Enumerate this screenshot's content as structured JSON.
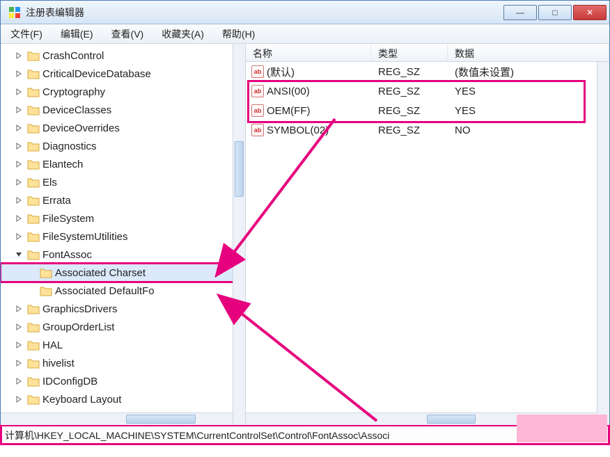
{
  "window": {
    "title": "注册表编辑器",
    "btn_min": "—",
    "btn_max": "□",
    "btn_close": "✕"
  },
  "menu": {
    "file": "文件(F)",
    "edit": "编辑(E)",
    "view": "查看(V)",
    "favorites": "收藏夹(A)",
    "help": "帮助(H)"
  },
  "tree": {
    "items": [
      {
        "label": "CrashControl",
        "depth": 3
      },
      {
        "label": "CriticalDeviceDatabase",
        "depth": 3
      },
      {
        "label": "Cryptography",
        "depth": 3
      },
      {
        "label": "DeviceClasses",
        "depth": 3
      },
      {
        "label": "DeviceOverrides",
        "depth": 3
      },
      {
        "label": "Diagnostics",
        "depth": 3
      },
      {
        "label": "Elantech",
        "depth": 3
      },
      {
        "label": "Els",
        "depth": 3
      },
      {
        "label": "Errata",
        "depth": 3
      },
      {
        "label": "FileSystem",
        "depth": 3
      },
      {
        "label": "FileSystemUtilities",
        "depth": 3
      },
      {
        "label": "FontAssoc",
        "depth": 3,
        "expanded": true
      },
      {
        "label": "Associated Charset",
        "depth": 4,
        "selected": true
      },
      {
        "label": "Associated DefaultFo",
        "depth": 4
      },
      {
        "label": "GraphicsDrivers",
        "depth": 3
      },
      {
        "label": "GroupOrderList",
        "depth": 3
      },
      {
        "label": "HAL",
        "depth": 3
      },
      {
        "label": "hivelist",
        "depth": 3
      },
      {
        "label": "IDConfigDB",
        "depth": 3
      },
      {
        "label": "Keyboard Layout",
        "depth": 3
      }
    ]
  },
  "list": {
    "header": {
      "name": "名称",
      "type": "类型",
      "data": "数据"
    },
    "rows": [
      {
        "name": "(默认)",
        "type": "REG_SZ",
        "data": "(数值未设置)"
      },
      {
        "name": "ANSI(00)",
        "type": "REG_SZ",
        "data": "YES"
      },
      {
        "name": "OEM(FF)",
        "type": "REG_SZ",
        "data": "YES"
      },
      {
        "name": "SYMBOL(02)",
        "type": "REG_SZ",
        "data": "NO"
      }
    ]
  },
  "statusbar": {
    "path": "计算机\\HKEY_LOCAL_MACHINE\\SYSTEM\\CurrentControlSet\\Control\\FontAssoc\\Associ"
  }
}
